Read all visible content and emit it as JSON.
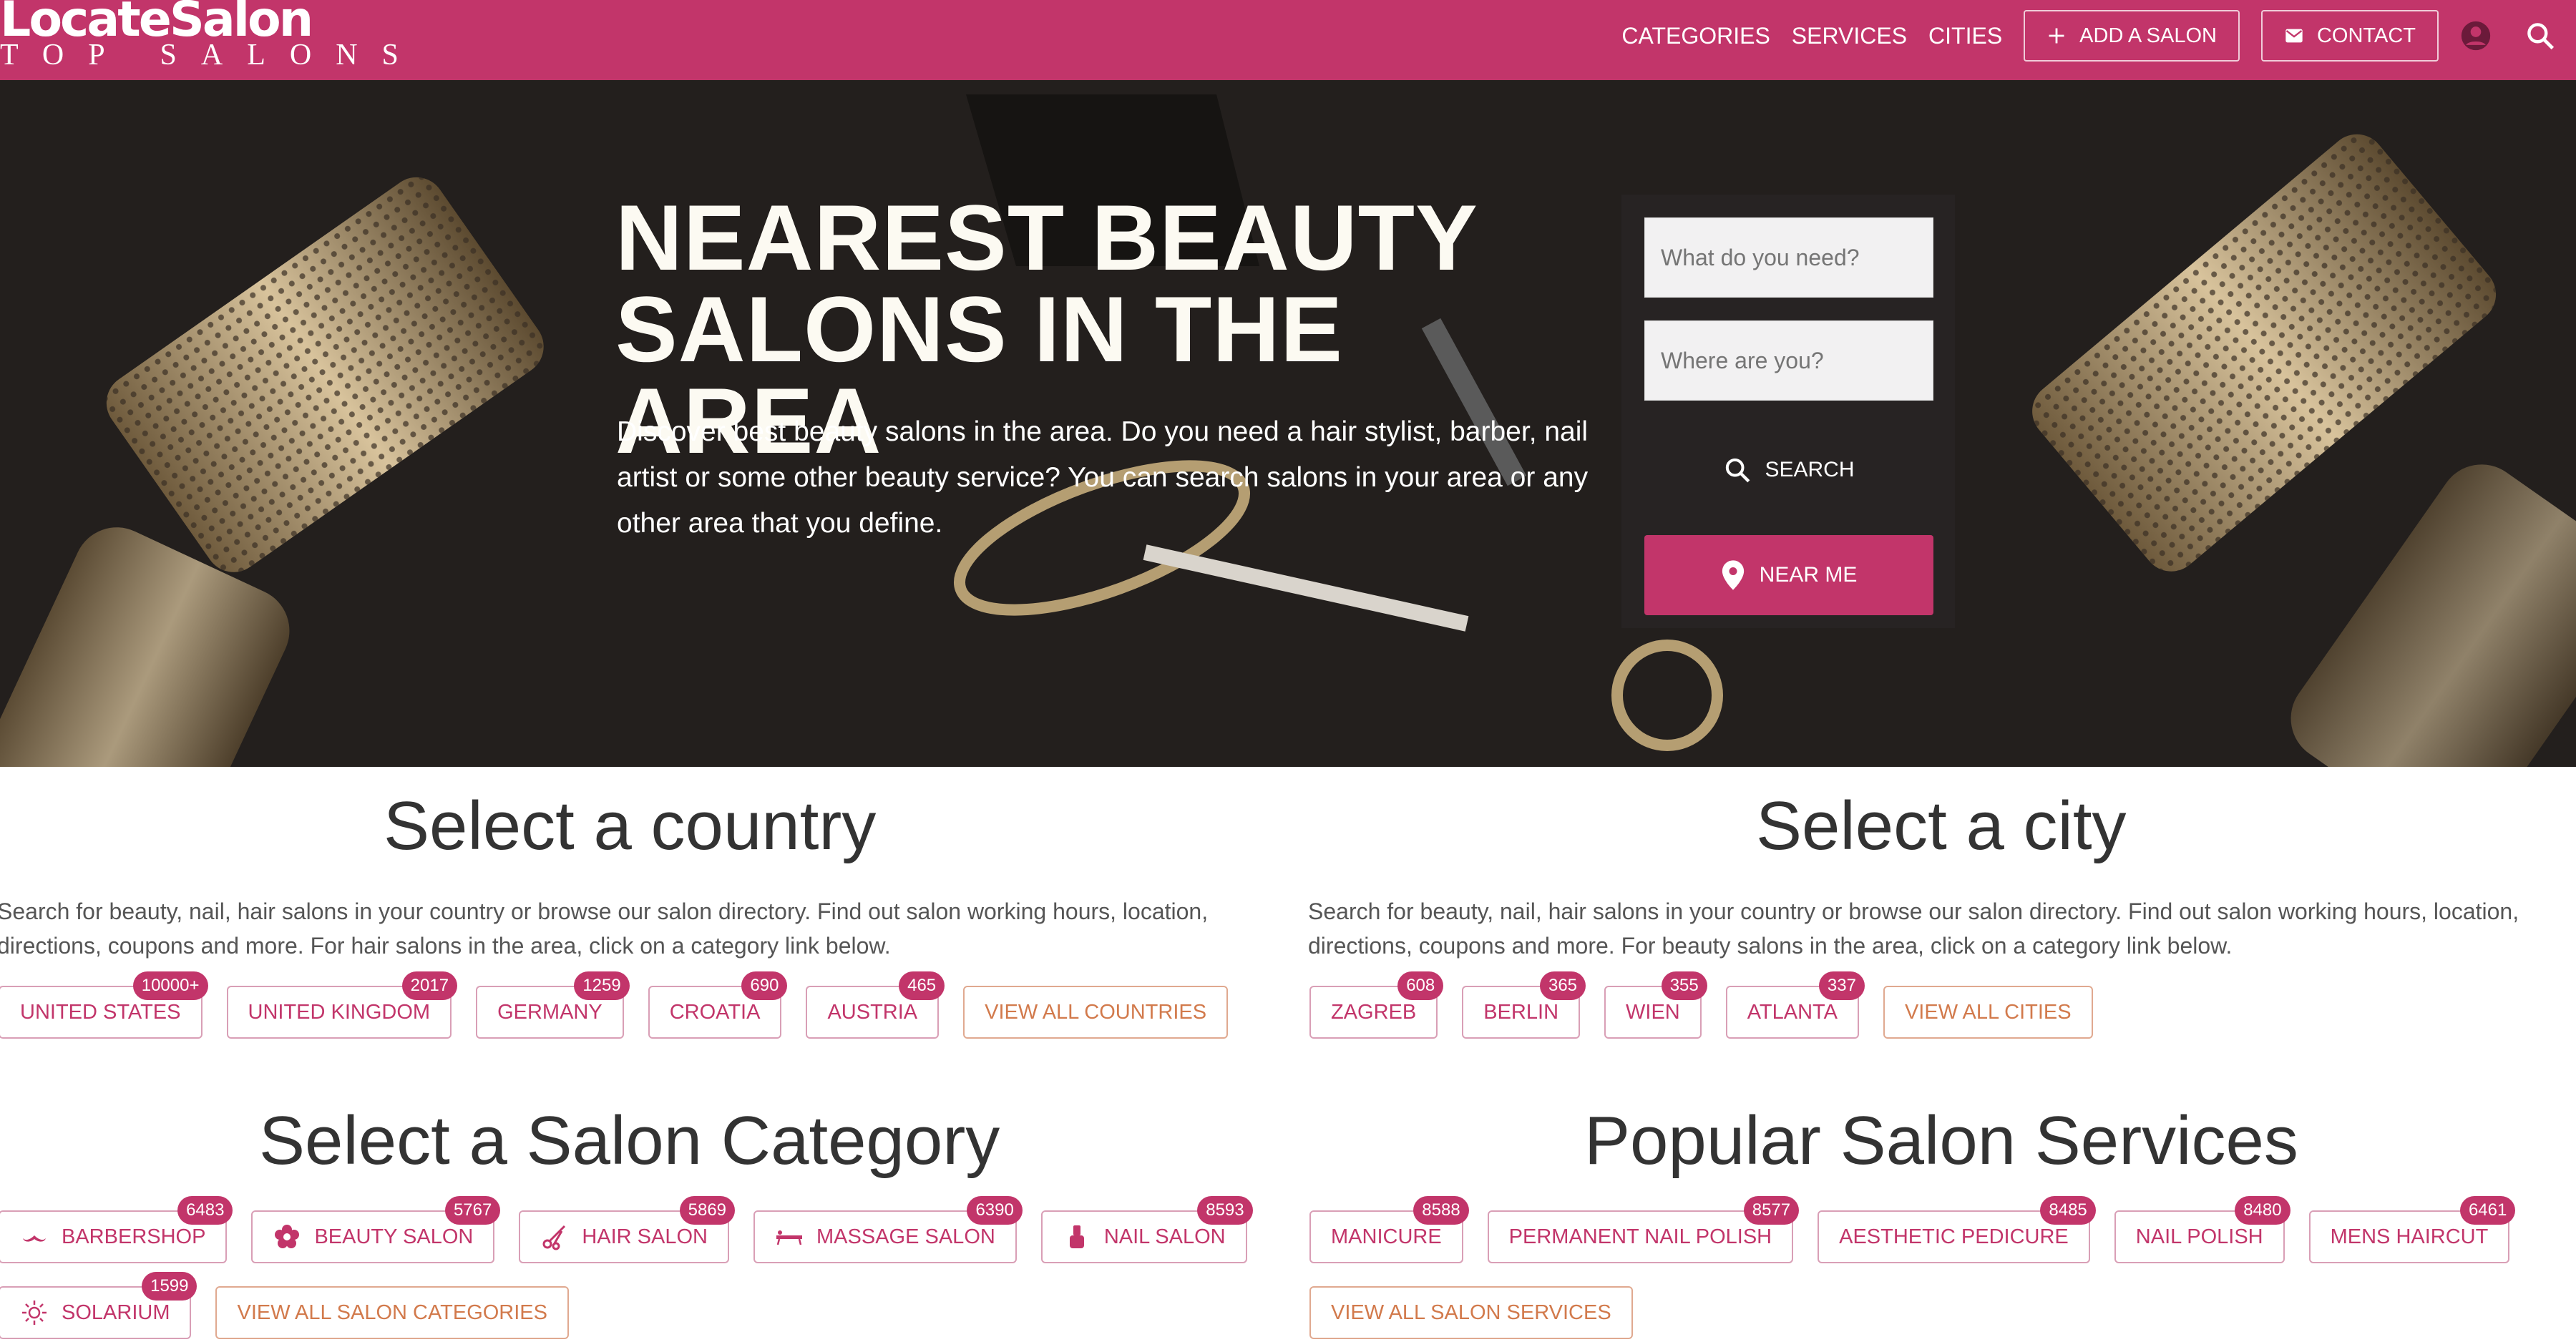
{
  "brand": {
    "name": "LocateSalon",
    "tagline": "TOP SALONS"
  },
  "nav": {
    "items": [
      "CATEGORIES",
      "SERVICES",
      "CITIES"
    ],
    "add_salon": "ADD A SALON",
    "contact": "CONTACT",
    "account_icon": "account-circle-icon",
    "search_icon": "search-icon"
  },
  "hero": {
    "title": "NEAREST BEAUTY SALONS IN THE AREA",
    "description": "Discover best beauty salons in the area. Do you need a hair stylist, barber, nail artist or some other beauty service? You can search salons in your area or any other area that you define.",
    "what_placeholder": "What do you need?",
    "where_placeholder": "Where are you?",
    "search_label": "SEARCH",
    "near_me_label": "NEAR ME"
  },
  "country": {
    "title": "Select a country",
    "description": "Search for beauty, nail, hair salons in your country or browse our salon directory. Find out salon working hours, location, directions, coupons and more. For hair salons in the area, click on a category link below.",
    "items": [
      {
        "label": "UNITED STATES",
        "count": "10000+"
      },
      {
        "label": "UNITED KINGDOM",
        "count": "2017"
      },
      {
        "label": "GERMANY",
        "count": "1259"
      },
      {
        "label": "CROATIA",
        "count": "690"
      },
      {
        "label": "AUSTRIA",
        "count": "465"
      }
    ],
    "view_all": "VIEW ALL COUNTRIES"
  },
  "city": {
    "title": "Select a city",
    "description": "Search for beauty, nail, hair salons in your country or browse our salon directory. Find out salon working hours, location, directions, coupons and more. For beauty salons in the area, click on a category link below.",
    "items": [
      {
        "label": "ZAGREB",
        "count": "608"
      },
      {
        "label": "BERLIN",
        "count": "365"
      },
      {
        "label": "WIEN",
        "count": "355"
      },
      {
        "label": "ATLANTA",
        "count": "337"
      }
    ],
    "view_all": "VIEW ALL CITIES"
  },
  "category": {
    "title": "Select a Salon Category",
    "items": [
      {
        "label": "BARBERSHOP",
        "count": "6483",
        "icon": "mustache-icon"
      },
      {
        "label": "BEAUTY SALON",
        "count": "5767",
        "icon": "flower-icon"
      },
      {
        "label": "HAIR SALON",
        "count": "5869",
        "icon": "scissors-icon"
      },
      {
        "label": "MASSAGE SALON",
        "count": "6390",
        "icon": "massage-table-icon"
      },
      {
        "label": "NAIL SALON",
        "count": "8593",
        "icon": "nail-polish-icon"
      },
      {
        "label": "SOLARIUM",
        "count": "1599",
        "icon": "sun-icon"
      }
    ],
    "view_all": "VIEW ALL SALON CATEGORIES"
  },
  "services": {
    "title": "Popular Salon Services",
    "items": [
      {
        "label": "MANICURE",
        "count": "8588"
      },
      {
        "label": "PERMANENT NAIL POLISH",
        "count": "8577"
      },
      {
        "label": "AESTHETIC PEDICURE",
        "count": "8485"
      },
      {
        "label": "NAIL POLISH",
        "count": "8480"
      },
      {
        "label": "MENS HAIRCUT",
        "count": "6461"
      }
    ],
    "view_all": "VIEW ALL SALON SERVICES"
  },
  "colors": {
    "brand": "#c2356a",
    "view_all": "#d27a4c",
    "hero_bg": "#221e1c"
  }
}
